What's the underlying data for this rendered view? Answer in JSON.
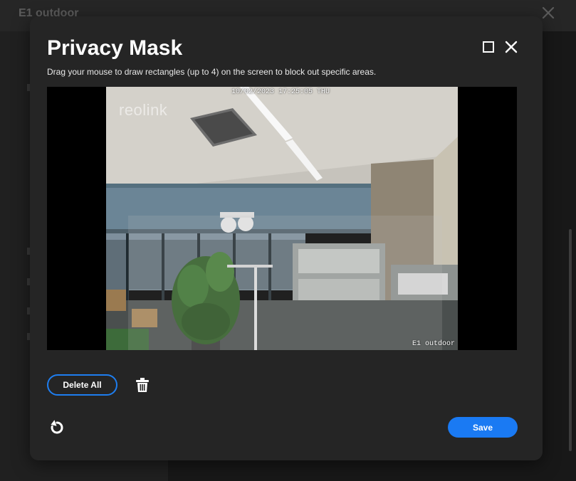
{
  "background": {
    "title": "E1 outdoor",
    "close_icon": "close-icon"
  },
  "modal": {
    "title": "Privacy Mask",
    "description": "Drag your mouse to draw rectangles (up to 4) on the screen to block out specific areas.",
    "maximize_icon": "maximize-icon",
    "close_icon": "close-icon"
  },
  "video": {
    "timestamp": "10/02/2023 17:25:05 THU",
    "camera_name": "E1 outdoor",
    "watermark": "reolink"
  },
  "actions": {
    "delete_all_label": "Delete All",
    "trash_icon": "trash-icon",
    "reset_icon": "reset-icon",
    "save_label": "Save"
  },
  "colors": {
    "accent": "#1a7af3",
    "modal_bg": "#252525",
    "page_bg": "#1c1c1c"
  }
}
